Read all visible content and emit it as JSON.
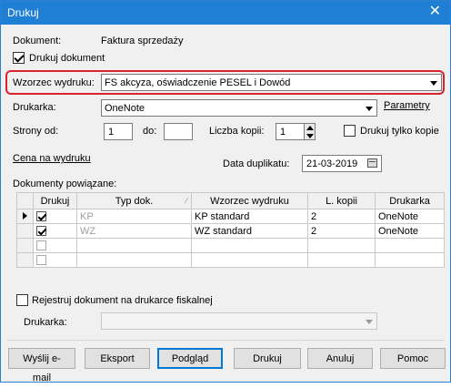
{
  "window": {
    "title": "Drukuj"
  },
  "dokument": {
    "label": "Dokument:",
    "value": "Faktura sprzedaży"
  },
  "drukuj_dokument": {
    "label": "Drukuj dokument",
    "checked": true
  },
  "wzorzec": {
    "label": "Wzorzec wydruku:",
    "value": "FS akcyza, oświadczenie PESEL i Dowód"
  },
  "drukarka": {
    "label": "Drukarka:",
    "value": "OneNote",
    "parametry_link": "Parametry"
  },
  "strony": {
    "od_label": "Strony od:",
    "od_value": "1",
    "do_label": "do:",
    "do_value": ""
  },
  "kopie": {
    "label": "Liczba kopii:",
    "value": "1",
    "tylko_kopie_label": "Drukuj tylko kopie",
    "tylko_kopie_checked": false
  },
  "cena_link": "Cena na wydruku",
  "duplikat": {
    "label": "Data duplikatu:",
    "value": "21-03-2019"
  },
  "powiazane": {
    "label": "Dokumenty powiązane:",
    "columns": [
      "Drukuj",
      "Typ dok.",
      "Wzorzec wydruku",
      "L. kopii",
      "Drukarka"
    ],
    "rows": [
      {
        "drukuj": true,
        "typ": "KP",
        "wzorzec": "KP standard",
        "kopii": "2",
        "drukarka": "OneNote",
        "current": true
      },
      {
        "drukuj": true,
        "typ": "WZ",
        "wzorzec": "WZ standard",
        "kopii": "2",
        "drukarka": "OneNote",
        "current": false
      },
      {
        "drukuj": false,
        "typ": "",
        "wzorzec": "",
        "kopii": "",
        "drukarka": "",
        "current": false
      },
      {
        "drukuj": false,
        "typ": "",
        "wzorzec": "",
        "kopii": "",
        "drukarka": "",
        "current": false
      }
    ]
  },
  "fiskalna": {
    "label": "Rejestruj dokument na drukarce fiskalnej",
    "checked": false,
    "drukarka_label": "Drukarka:",
    "drukarka_value": ""
  },
  "buttons": {
    "email": "Wyślij e-mail",
    "eksport": "Eksport",
    "podglad": "Podgląd",
    "drukuj": "Drukuj",
    "anuluj": "Anuluj",
    "pomoc": "Pomoc"
  },
  "icons": {
    "close": "close-icon",
    "dropdown": "chevron-down-icon",
    "calendar": "calendar-icon",
    "row_pointer": "row-pointer-icon"
  }
}
